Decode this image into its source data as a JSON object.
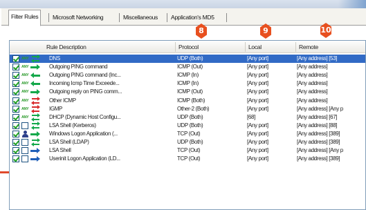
{
  "tabs": [
    {
      "label": "Filter Rules",
      "active": true
    },
    {
      "label": "Microsoft Networking",
      "active": false
    },
    {
      "label": "Miscellaneous",
      "active": false
    },
    {
      "label": "Application's MD5",
      "active": false
    }
  ],
  "columns": {
    "description": "Rule Description",
    "protocol": "Protocol",
    "local": "Local",
    "remote": "Remote"
  },
  "badges": {
    "protocol": "8",
    "local": "9",
    "remote": "10"
  },
  "any_label": "ANY",
  "rows": [
    {
      "checked": true,
      "zone": "any",
      "dir": "both",
      "desc": "DNS",
      "protocol": "UDP (Both)",
      "local": "[Any port]",
      "remote": "[Any address] [53]",
      "selected": true
    },
    {
      "checked": true,
      "zone": "any",
      "dir": "out",
      "desc": "Outgoing PING command",
      "protocol": "ICMP (Out)",
      "local": "[Any port]",
      "remote": "[Any address]",
      "selected": false
    },
    {
      "checked": true,
      "zone": "any",
      "dir": "in",
      "desc": "Outgoing PING command (Inc...",
      "protocol": "ICMP (In)",
      "local": "[Any port]",
      "remote": "[Any address]",
      "selected": false
    },
    {
      "checked": true,
      "zone": "any",
      "dir": "in",
      "desc": "Incoming Icmp Time Exceede...",
      "protocol": "ICMP (In)",
      "local": "[Any port]",
      "remote": "[Any address]",
      "selected": false
    },
    {
      "checked": true,
      "zone": "any",
      "dir": "out",
      "desc": "Outgoing reply on PING comm...",
      "protocol": "ICMP (Out)",
      "local": "[Any port]",
      "remote": "[Any address]",
      "selected": false
    },
    {
      "checked": true,
      "zone": "any",
      "dir": "both-red",
      "desc": "Other ICMP",
      "protocol": "ICMP (Both)",
      "local": "[Any port]",
      "remote": "[Any address]",
      "selected": false
    },
    {
      "checked": true,
      "zone": "any",
      "dir": "both-red",
      "desc": "IGMP",
      "protocol": "Other-2 (Both)",
      "local": "[Any port]",
      "remote": "[Any address] [Any p",
      "selected": false
    },
    {
      "checked": true,
      "zone": "any",
      "dir": "both",
      "desc": "DHCP (Dynamic Host Configu...",
      "protocol": "UDP (Both)",
      "local": "[68]",
      "remote": "[Any address] [67]",
      "selected": false
    },
    {
      "checked": true,
      "zone": "box",
      "dir": "both",
      "desc": "LSA Shell (Kerberos)",
      "protocol": "UDP (Both)",
      "local": "[Any port]",
      "remote": "[Any address] [88]",
      "selected": false
    },
    {
      "checked": true,
      "zone": "user",
      "dir": "out",
      "desc": "Windows Logon Application (...",
      "protocol": "TCP (Out)",
      "local": "[Any port]",
      "remote": "[Any address] [389]",
      "selected": false
    },
    {
      "checked": true,
      "zone": "box",
      "dir": "both",
      "desc": "LSA Shell (LDAP)",
      "protocol": "UDP (Both)",
      "local": "[Any port]",
      "remote": "[Any address] [389]",
      "selected": false
    },
    {
      "checked": true,
      "zone": "box",
      "dir": "out-blue",
      "desc": "LSA Shell",
      "protocol": "TCP (Out)",
      "local": "[Any port]",
      "remote": "[Any address] [Any p",
      "selected": false
    },
    {
      "checked": true,
      "zone": "box",
      "dir": "out-blue",
      "desc": "Userinit Logon Application (LD...",
      "protocol": "TCP (Out)",
      "local": "[Any port]",
      "remote": "[Any address] [389]",
      "selected": false
    }
  ]
}
